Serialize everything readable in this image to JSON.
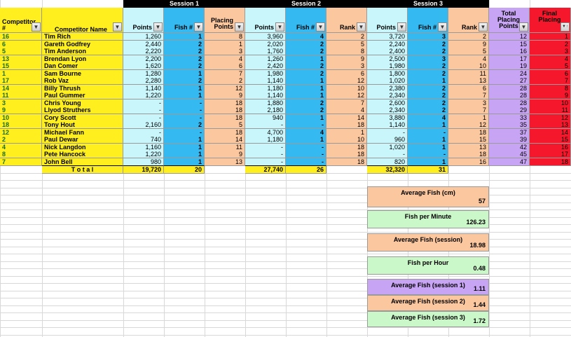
{
  "colors": {
    "yellow": "#ffef1f",
    "cyan_light": "#c9f6fb",
    "cyan": "#35b9f1",
    "peach": "#fbc79f",
    "purple": "#c8a4f4",
    "red": "#f5172c",
    "green_light": "#cbf8c8",
    "black": "#000000"
  },
  "session_labels": [
    "Session 1",
    "Session 2",
    "Session 3"
  ],
  "headers": {
    "competitor_num": "Competitor #",
    "competitor_name": "Competitor Name",
    "s1_points": "Points",
    "s1_fish": "Fish #",
    "s1_placing": "Placing Points",
    "s2_points": "Points",
    "s2_fish": "Fish #",
    "s2_rank": "Rank",
    "s3_points": "Points",
    "s3_fish": "Fish #",
    "s3_rank": "Rank",
    "total_placing": "Total Placing Points",
    "final_placing": "Final Placing"
  },
  "rows": [
    {
      "id": "16",
      "name": "Tim Rich",
      "s1p": "1,260",
      "s1f": "1",
      "s1pl": "8",
      "s2p": "3,960",
      "s2f": "4",
      "s2r": "2",
      "s3p": "3,720",
      "s3f": "3",
      "s3r": "2",
      "tot": "12",
      "fin": "1"
    },
    {
      "id": "6",
      "name": "Gareth Godfrey",
      "s1p": "2,440",
      "s1f": "2",
      "s1pl": "1",
      "s2p": "2,020",
      "s2f": "2",
      "s2r": "5",
      "s3p": "2,240",
      "s3f": "2",
      "s3r": "9",
      "tot": "15",
      "fin": "2"
    },
    {
      "id": "5",
      "name": "Tim Anderson",
      "s1p": "2,220",
      "s1f": "2",
      "s1pl": "3",
      "s2p": "1,760",
      "s2f": "2",
      "s2r": "8",
      "s3p": "2,400",
      "s3f": "2",
      "s3r": "5",
      "tot": "16",
      "fin": "3"
    },
    {
      "id": "13",
      "name": "Brendan Lyon",
      "s1p": "2,200",
      "s1f": "2",
      "s1pl": "4",
      "s2p": "1,260",
      "s2f": "1",
      "s2r": "9",
      "s3p": "2,500",
      "s3f": "3",
      "s3r": "4",
      "tot": "17",
      "fin": "4"
    },
    {
      "id": "15",
      "name": "Dan Comer",
      "s1p": "1,620",
      "s1f": "2",
      "s1pl": "6",
      "s2p": "2,420",
      "s2f": "2",
      "s2r": "3",
      "s3p": "1,980",
      "s3f": "2",
      "s3r": "10",
      "tot": "19",
      "fin": "5"
    },
    {
      "id": "1",
      "name": "Sam Bourne",
      "s1p": "1,280",
      "s1f": "1",
      "s1pl": "7",
      "s2p": "1,980",
      "s2f": "2",
      "s2r": "6",
      "s3p": "1,800",
      "s3f": "2",
      "s3r": "11",
      "tot": "24",
      "fin": "6"
    },
    {
      "id": "17",
      "name": "Rob Vaz",
      "s1p": "2,280",
      "s1f": "2",
      "s1pl": "2",
      "s2p": "1,140",
      "s2f": "1",
      "s2r": "12",
      "s3p": "1,020",
      "s3f": "1",
      "s3r": "13",
      "tot": "27",
      "fin": "7"
    },
    {
      "id": "14",
      "name": "Billy Thrush",
      "s1p": "1,140",
      "s1f": "1",
      "s1pl": "12",
      "s2p": "1,180",
      "s2f": "1",
      "s2r": "10",
      "s3p": "2,380",
      "s3f": "2",
      "s3r": "6",
      "tot": "28",
      "fin": "8"
    },
    {
      "id": "11",
      "name": "Paul Gummer",
      "s1p": "1,220",
      "s1f": "1",
      "s1pl": "9",
      "s2p": "1,140",
      "s2f": "1",
      "s2r": "12",
      "s3p": "2,340",
      "s3f": "2",
      "s3r": "7",
      "tot": "28",
      "fin": "9"
    },
    {
      "id": "3",
      "name": "Chris Young",
      "s1p": "-",
      "s1f": "-",
      "s1pl": "18",
      "s2p": "1,880",
      "s2f": "2",
      "s2r": "7",
      "s3p": "2,600",
      "s3f": "2",
      "s3r": "3",
      "tot": "28",
      "fin": "10"
    },
    {
      "id": "9",
      "name": "Llyod Struthers",
      "s1p": "-",
      "s1f": "-",
      "s1pl": "18",
      "s2p": "2,180",
      "s2f": "2",
      "s2r": "4",
      "s3p": "2,340",
      "s3f": "2",
      "s3r": "7",
      "tot": "29",
      "fin": "11"
    },
    {
      "id": "10",
      "name": "Cory Scott",
      "s1p": "-",
      "s1f": "-",
      "s1pl": "18",
      "s2p": "940",
      "s2f": "1",
      "s2r": "14",
      "s3p": "3,880",
      "s3f": "4",
      "s3r": "1",
      "tot": "33",
      "fin": "12"
    },
    {
      "id": "18",
      "name": "Tony Hout",
      "s1p": "2,160",
      "s1f": "2",
      "s1pl": "5",
      "s2p": "-",
      "s2f": "-",
      "s2r": "18",
      "s3p": "1,140",
      "s3f": "1",
      "s3r": "12",
      "tot": "35",
      "fin": "13"
    },
    {
      "id": "12",
      "name": "Michael Fann",
      "s1p": "-",
      "s1f": "-",
      "s1pl": "18",
      "s2p": "4,700",
      "s2f": "4",
      "s2r": "1",
      "s3p": "-",
      "s3f": "-",
      "s3r": "18",
      "tot": "37",
      "fin": "14"
    },
    {
      "id": "2",
      "name": "Paul Dewar",
      "s1p": "740",
      "s1f": "1",
      "s1pl": "14",
      "s2p": "1,180",
      "s2f": "1",
      "s2r": "10",
      "s3p": "960",
      "s3f": "1",
      "s3r": "15",
      "tot": "39",
      "fin": "15"
    },
    {
      "id": "4",
      "name": "Nick Langdon",
      "s1p": "1,160",
      "s1f": "1",
      "s1pl": "11",
      "s2p": "-",
      "s2f": "-",
      "s2r": "18",
      "s3p": "1,020",
      "s3f": "1",
      "s3r": "13",
      "tot": "42",
      "fin": "16"
    },
    {
      "id": "8",
      "name": "Pete Hancock",
      "s1p": "1,220",
      "s1f": "1",
      "s1pl": "9",
      "s2p": "-",
      "s2f": "-",
      "s2r": "18",
      "s3p": "-",
      "s3f": "-",
      "s3r": "18",
      "tot": "45",
      "fin": "17"
    },
    {
      "id": "7",
      "name": "John Bell",
      "s1p": "980",
      "s1f": "1",
      "s1pl": "13",
      "s2p": "-",
      "s2f": "-",
      "s2r": "18",
      "s3p": "820",
      "s3f": "1",
      "s3r": "16",
      "tot": "47",
      "fin": "18"
    }
  ],
  "totals": {
    "label": "T o t a l",
    "s1_points": "19,720",
    "s1_fish": "20",
    "s2_points": "27,740",
    "s2_fish": "26",
    "s3_points": "32,320",
    "s3_fish": "31"
  },
  "stats": [
    {
      "label": "Average Fish (cm)",
      "value": "57",
      "color": "peach"
    },
    {
      "label": "Fish per Minute",
      "value": "126.23",
      "color": "green_light"
    },
    {
      "label": "Average Fish (session)",
      "value": "18.98",
      "color": "peach"
    },
    {
      "label": "Fish per Hour",
      "value": "0.48",
      "color": "green_light"
    },
    {
      "label": "Average Fish (session 1)",
      "value": "1.11",
      "color": "purple"
    },
    {
      "label": "Average Fish (session 2)",
      "value": "1.44",
      "color": "peach"
    },
    {
      "label": "Average Fish (session 3)",
      "value": "1.72",
      "color": "green_light"
    }
  ]
}
